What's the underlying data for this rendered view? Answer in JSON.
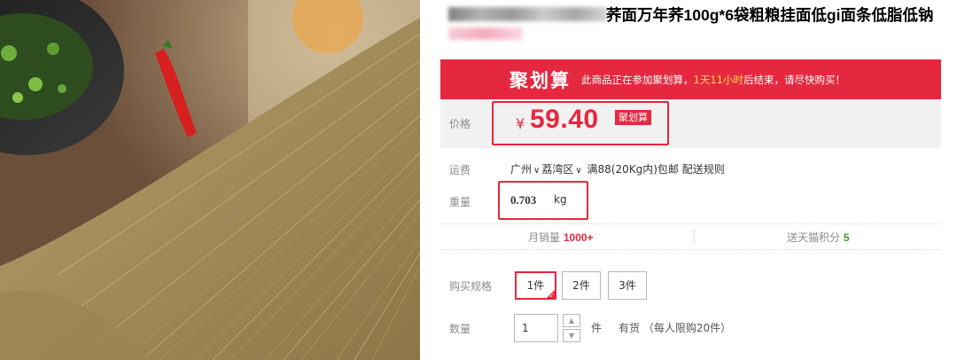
{
  "product": {
    "title_visible": "荞面万年荞100g*6袋粗粮挂面低gi面条低脂低钠"
  },
  "banner": {
    "logo": "聚划算",
    "text_before": "此商品正在参加聚划算，",
    "highlight": "1天11小时",
    "text_after": "后结束，请尽快购买！",
    "accent_color": "#e5283f"
  },
  "price": {
    "label": "价格",
    "currency": "¥",
    "value": "59.40",
    "tag": "聚划算"
  },
  "shipping": {
    "label": "运费",
    "city": "广州",
    "district": "荔湾区",
    "rule": "满88(20Kg内)包邮 配送规则"
  },
  "weight": {
    "label": "重量",
    "value": "0.703",
    "unit": "kg"
  },
  "sales": {
    "monthly_label": "月销量",
    "monthly_value": "1000+",
    "points_label": "送天猫积分",
    "points_value": "5"
  },
  "spec": {
    "label": "购买规格",
    "options": [
      "1件",
      "2件",
      "3件"
    ],
    "selected_index": 0
  },
  "quantity": {
    "label": "数量",
    "value": "1",
    "unit": "件",
    "stock_text": "有货 （每人限购20件）",
    "up_icon": "chevron-up-icon",
    "down_icon": "chevron-down-icon"
  }
}
